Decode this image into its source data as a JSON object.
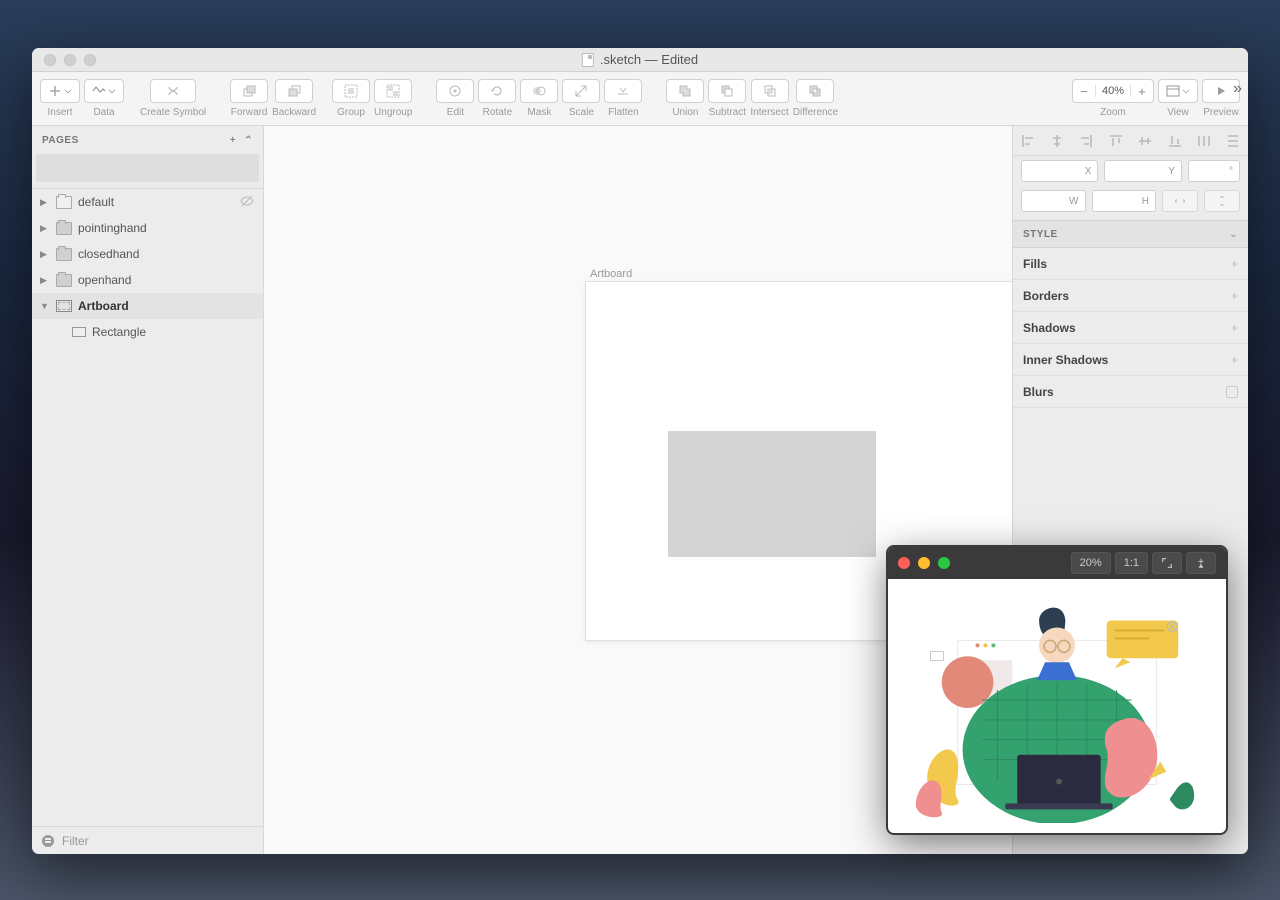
{
  "window": {
    "title": ".sketch — Edited"
  },
  "toolbar": {
    "insert": "Insert",
    "data": "Data",
    "createSymbol": "Create Symbol",
    "forward": "Forward",
    "backward": "Backward",
    "group": "Group",
    "ungroup": "Ungroup",
    "edit": "Edit",
    "rotate": "Rotate",
    "mask": "Mask",
    "scale": "Scale",
    "flatten": "Flatten",
    "union": "Union",
    "subtract": "Subtract",
    "intersect": "Intersect",
    "difference": "Difference",
    "zoom": "Zoom",
    "zoomValue": "40%",
    "view": "View",
    "preview": "Preview"
  },
  "sidebar": {
    "pagesLabel": "PAGES",
    "layers": [
      {
        "name": "default",
        "folder": true,
        "light": true,
        "hidden": true
      },
      {
        "name": "pointinghand",
        "folder": true
      },
      {
        "name": "closedhand",
        "folder": true
      },
      {
        "name": "openhand",
        "folder": true
      }
    ],
    "artboardLabel": "Artboard",
    "rectangleLabel": "Rectangle",
    "filterPlaceholder": "Filter"
  },
  "canvas": {
    "artboardLabel": "Artboard"
  },
  "inspector": {
    "xLabel": "X",
    "yLabel": "Y",
    "angleLabel": "°",
    "wLabel": "W",
    "hLabel": "H",
    "styleLabel": "STYLE",
    "sections": [
      "Fills",
      "Borders",
      "Shadows",
      "Inner Shadows",
      "Blurs"
    ]
  },
  "previewWindow": {
    "zoom": "20%",
    "scaleBtn": "1:1"
  }
}
